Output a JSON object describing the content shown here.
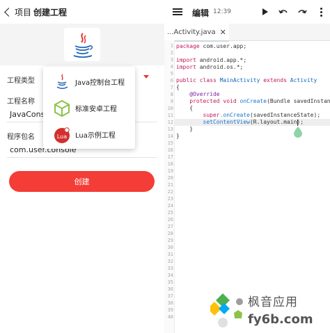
{
  "left": {
    "back_label": "项目",
    "title": "创建工程",
    "type_label": "工程类型",
    "name_label": "工程名称",
    "name_value": "JavaConsole",
    "package_label": "程序包名",
    "package_value": "com.user.console",
    "create_button": "创建",
    "menu_items": [
      {
        "label": "Java控制台工程",
        "icon": "java-icon"
      },
      {
        "label": "标准安卓工程",
        "icon": "android-cube-icon"
      },
      {
        "label": "Lua示例工程",
        "icon": "lua-icon"
      }
    ]
  },
  "right": {
    "title": "编辑",
    "time": "12:39",
    "tab_label": "...Activity.java",
    "tab_close": "✕",
    "line_numbers": [
      "1",
      "2",
      "3",
      "4",
      "5",
      "6",
      "7",
      "8",
      "9",
      "10",
      "11",
      "12",
      "13",
      "14",
      "15",
      "16",
      "17",
      "18",
      "19",
      "20",
      "21",
      "22",
      "23",
      "24",
      "25",
      "26",
      "27",
      "28",
      "29",
      "30",
      "31",
      "32",
      "33",
      "34",
      "35",
      "36",
      "37",
      "38",
      "39",
      "40"
    ],
    "code": {
      "l1_kw": "package",
      "l1_rest": " com.user.app;",
      "l3_kw": "import",
      "l3_rest": " android.app.*;",
      "l4_kw": "import",
      "l4_rest": " android.os.*;",
      "l6_kw1": "public class",
      "l6_cls": " MainActivity",
      "l6_kw2": " extends",
      "l6_parent": " Activity",
      "l7": "{",
      "l8_ann": "    @Override",
      "l9_kw": "    protected void",
      "l9_fn": " onCreate",
      "l9_rest": "(Bundle savedInstance",
      "l10": "    {",
      "l11_kw": "        super",
      "l11_fn": ".onCreate",
      "l11_rest": "(savedInstanceState);",
      "l12_fn": "        setContentView",
      "l12_rest": "(R.layout.main);",
      "l13": "    }",
      "l14": "}"
    }
  },
  "watermark": {
    "line1": "枫音应用",
    "line2": "fy6b.com"
  },
  "colors": {
    "accent_red": "#f33d36",
    "keyword": "#c2185b",
    "type": "#1565c0"
  }
}
